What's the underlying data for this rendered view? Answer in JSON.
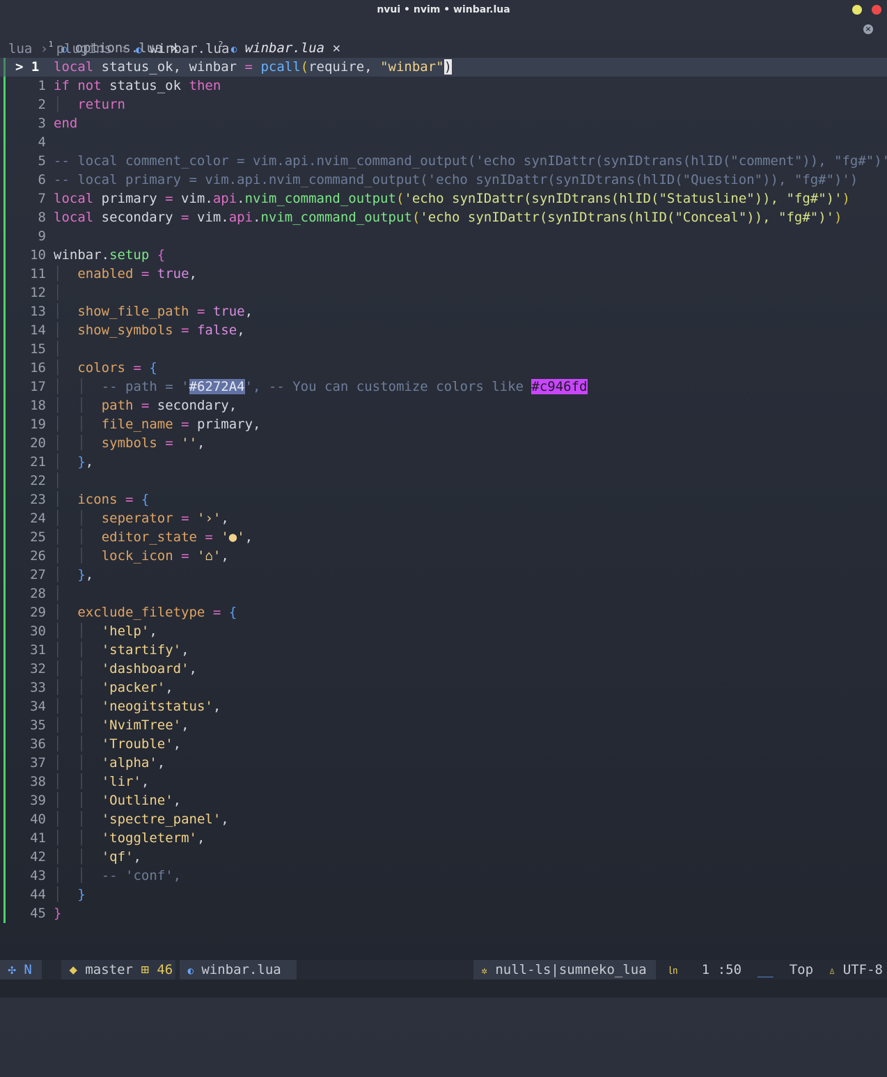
{
  "window": {
    "title": "nvui • nvim • winbar.lua"
  },
  "tabs": [
    {
      "num": "1",
      "name": "options.lua",
      "close": "✕"
    },
    {
      "num": "2",
      "name": "winbar.lua",
      "close": "✕"
    }
  ],
  "winbar": {
    "path1": "lua",
    "path2": "plugins",
    "file": "winbar.lua",
    "separator": "›"
  },
  "editor": {
    "current_line_marker": "> 1",
    "line_numbers": [
      "1",
      "2",
      "3",
      "4",
      "5",
      "6",
      "7",
      "8",
      "9",
      "10",
      "11",
      "12",
      "13",
      "14",
      "15",
      "16",
      "17",
      "18",
      "19",
      "20",
      "21",
      "22",
      "23",
      "24",
      "25",
      "26",
      "27",
      "28",
      "29",
      "30",
      "31",
      "32",
      "33",
      "34",
      "35",
      "36",
      "37",
      "38",
      "39",
      "40",
      "41",
      "42",
      "43",
      "44",
      "45"
    ],
    "color_hex_1": "#6272A4",
    "color_hex_2": "#c946fd"
  },
  "statusline": {
    "mode": "N",
    "branch": "master",
    "diff_count": "46",
    "file": "winbar.lua",
    "lsp": "null-ls|sumneko_lua",
    "line": "1",
    "col": ":50",
    "scroll": "Top",
    "encoding": "UTF-8"
  },
  "colors": {
    "background": "#2a2f3b",
    "keyword": "#e06ec7",
    "function": "#7ee787",
    "string": "#f2d38a",
    "comment": "#6f7d99",
    "git_added": "#4ed36b"
  }
}
